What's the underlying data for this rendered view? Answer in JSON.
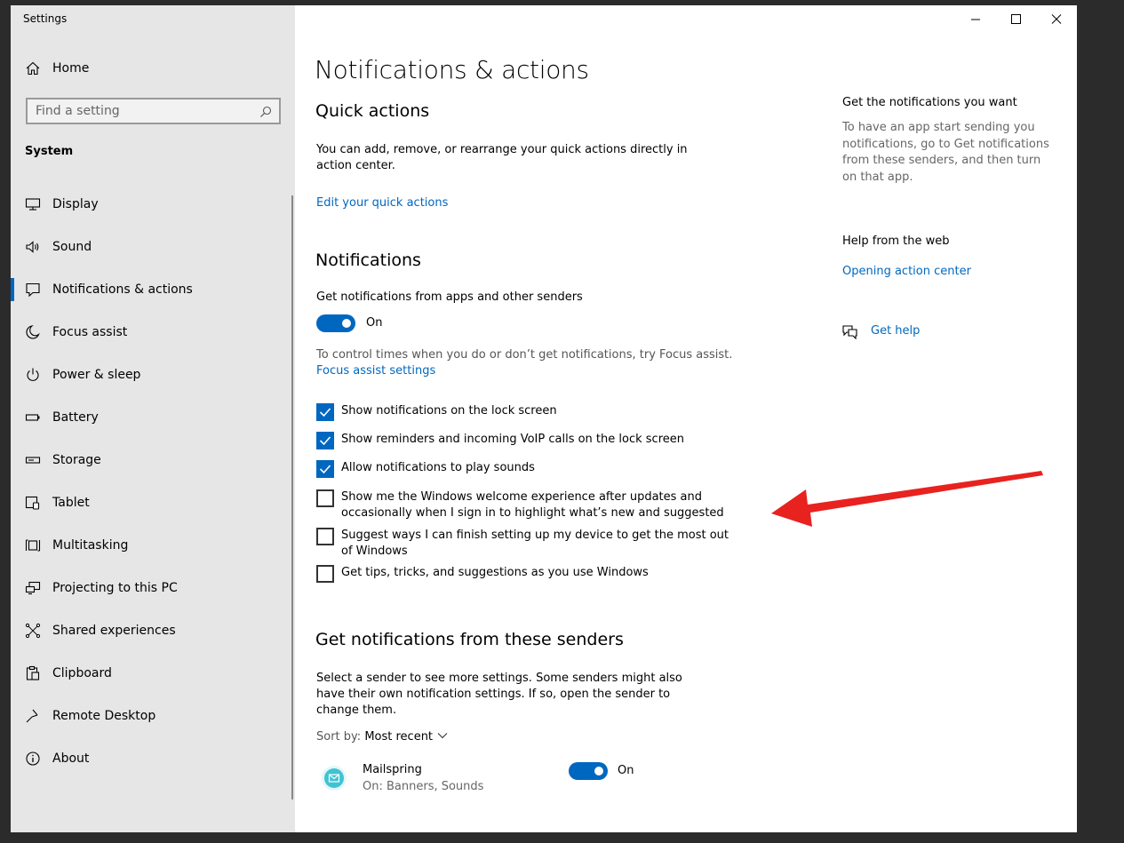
{
  "window": {
    "title": "Settings",
    "controls": [
      "minimize",
      "maximize",
      "close"
    ]
  },
  "sidebar": {
    "home_label": "Home",
    "search_placeholder": "Find a setting",
    "section_label": "System",
    "items": [
      {
        "label": "Display",
        "icon": "display-icon"
      },
      {
        "label": "Sound",
        "icon": "sound-icon"
      },
      {
        "label": "Notifications & actions",
        "icon": "notifications-icon",
        "selected": true
      },
      {
        "label": "Focus assist",
        "icon": "moon-icon"
      },
      {
        "label": "Power & sleep",
        "icon": "power-icon"
      },
      {
        "label": "Battery",
        "icon": "battery-icon"
      },
      {
        "label": "Storage",
        "icon": "storage-icon"
      },
      {
        "label": "Tablet",
        "icon": "tablet-icon"
      },
      {
        "label": "Multitasking",
        "icon": "multitasking-icon"
      },
      {
        "label": "Projecting to this PC",
        "icon": "projecting-icon"
      },
      {
        "label": "Shared experiences",
        "icon": "shared-experiences-icon"
      },
      {
        "label": "Clipboard",
        "icon": "clipboard-icon"
      },
      {
        "label": "Remote Desktop",
        "icon": "remote-desktop-icon"
      },
      {
        "label": "About",
        "icon": "info-icon"
      }
    ]
  },
  "main": {
    "page_title": "Notifications & actions",
    "quick_actions": {
      "heading": "Quick actions",
      "description": "You can add, remove, or rearrange your quick actions directly in action center.",
      "link": "Edit your quick actions"
    },
    "notifications": {
      "heading": "Notifications",
      "toggle_caption": "Get notifications from apps and other senders",
      "toggle_state": "On",
      "focus_hint": "To control times when you do or don’t get notifications, try Focus assist.",
      "focus_link": "Focus assist settings",
      "checkboxes": [
        {
          "label": "Show notifications on the lock screen",
          "checked": true
        },
        {
          "label": "Show reminders and incoming VoIP calls on the lock screen",
          "checked": true
        },
        {
          "label": "Allow notifications to play sounds",
          "checked": true
        },
        {
          "label": "Show me the Windows welcome experience after updates and occasionally when I sign in to highlight what’s new and suggested",
          "checked": false
        },
        {
          "label": "Suggest ways I can finish setting up my device to get the most out of Windows",
          "checked": false
        },
        {
          "label": "Get tips, tricks, and suggestions as you use Windows",
          "checked": false
        }
      ]
    },
    "senders": {
      "heading": "Get notifications from these senders",
      "description": "Select a sender to see more settings. Some senders might also have their own notification settings. If so, open the sender to change them.",
      "sort_label": "Sort by:",
      "sort_value": "Most recent",
      "apps": [
        {
          "name": "Mailspring",
          "status": "On: Banners, Sounds",
          "toggle_state": "On",
          "icon": "mailspring-icon"
        }
      ]
    }
  },
  "right_panel": {
    "info_title": "Get the notifications you want",
    "info_text": "To have an app start sending you notifications, go to Get notifications from these senders, and then turn on that app.",
    "help_title": "Help from the web",
    "help_link": "Opening action center",
    "get_help": "Get help"
  },
  "colors": {
    "accent": "#0067c0",
    "sidebar_bg": "#e6e6e6",
    "annotation_arrow": "#e8221f"
  }
}
